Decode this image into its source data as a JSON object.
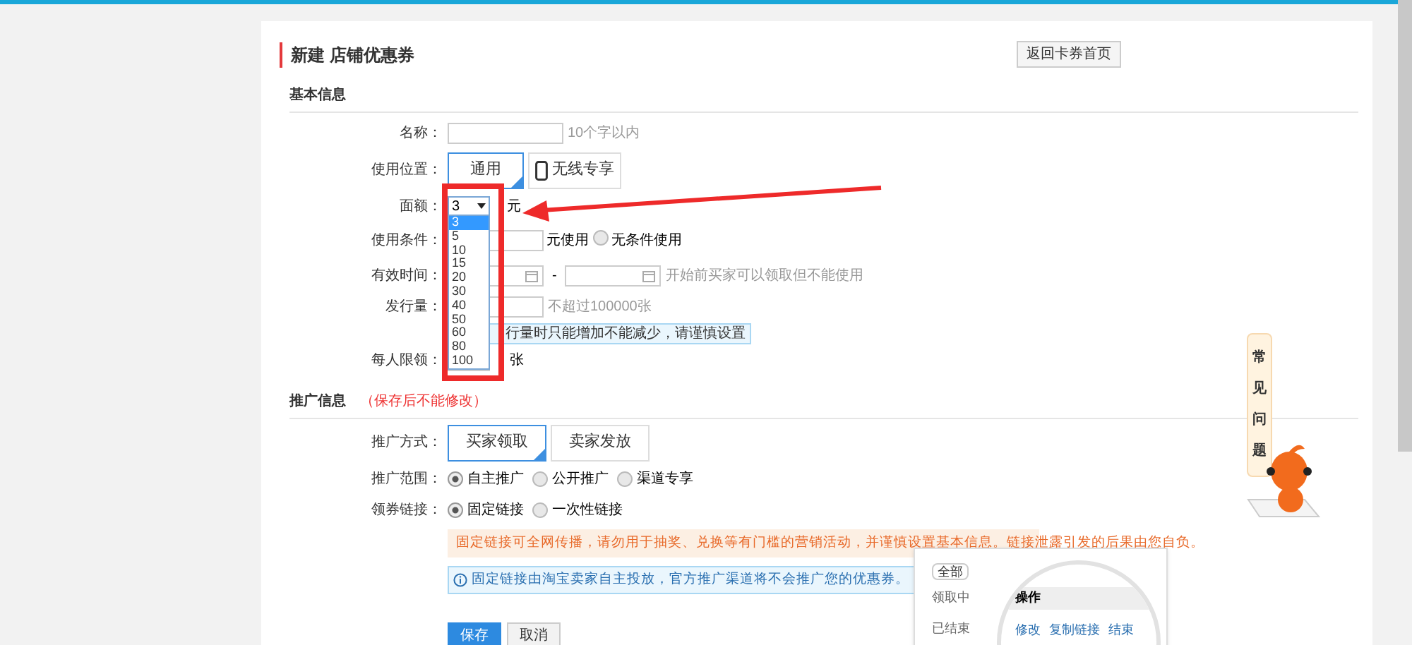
{
  "page_title": "新建 店铺优惠券",
  "back_button": "返回卡券首页",
  "basic": {
    "heading": "基本信息",
    "name": {
      "label": "名称：",
      "hint": "10个字以内"
    },
    "position": {
      "label": "使用位置：",
      "options": [
        {
          "label": "通用",
          "selected": true
        },
        {
          "label": "无线专享",
          "selected": false
        }
      ]
    },
    "amount": {
      "label": "面额：",
      "value": "3",
      "unit": "元",
      "options": [
        {
          "label": "3",
          "selected": true
        },
        {
          "label": "5",
          "selected": false
        },
        {
          "label": "10",
          "selected": false
        },
        {
          "label": "15",
          "selected": false
        },
        {
          "label": "20",
          "selected": false
        },
        {
          "label": "30",
          "selected": false
        },
        {
          "label": "40",
          "selected": false
        },
        {
          "label": "50",
          "selected": false
        },
        {
          "label": "60",
          "selected": false
        },
        {
          "label": "80",
          "selected": false
        },
        {
          "label": "100",
          "selected": false
        }
      ]
    },
    "condition": {
      "label": "使用条件：",
      "unit": "元使用",
      "radio": {
        "label": "无条件使用",
        "checked": false
      }
    },
    "validity": {
      "label": "有效时间：",
      "separator": "-",
      "hint": "开始前买家可以领取但不能使用"
    },
    "quantity": {
      "label": "发行量：",
      "hint": "不超过100000张",
      "notice": "行量时只能增加不能减少，请谨慎设置"
    },
    "limit": {
      "label": "每人限领：",
      "unit": "张"
    }
  },
  "promo": {
    "heading": "推广信息",
    "note": "（保存后不能修改）",
    "method": {
      "label": "推广方式：",
      "options": [
        {
          "label": "买家领取",
          "selected": true
        },
        {
          "label": "卖家发放",
          "selected": false
        }
      ]
    },
    "scope": {
      "label": "推广范围：",
      "options": [
        {
          "label": "自主推广",
          "selected": true
        },
        {
          "label": "公开推广",
          "selected": false
        },
        {
          "label": "渠道专享",
          "selected": false
        }
      ]
    },
    "link": {
      "label": "领券链接：",
      "options": [
        {
          "label": "固定链接",
          "selected": true
        },
        {
          "label": "一次性链接",
          "selected": false
        }
      ]
    },
    "warning": "固定链接可全网传播，请勿用于抽奖、兑换等有门槛的营销活动，并谨慎设置基本信息。链接泄露引发的后果由您自负。",
    "info": "固定链接由淘宝卖家自主投放，官方推广渠道将不会推广您的优惠券。"
  },
  "actions": [
    {
      "label": "保存",
      "kind": "primary"
    },
    {
      "label": "取消",
      "kind": "secondary"
    }
  ],
  "preview": {
    "filter": "全部",
    "column": "操作",
    "rows": [
      "领取中",
      "已结束"
    ],
    "links": [
      "修改",
      "复制链接",
      "结束"
    ]
  },
  "help": {
    "label": "常见问题"
  }
}
